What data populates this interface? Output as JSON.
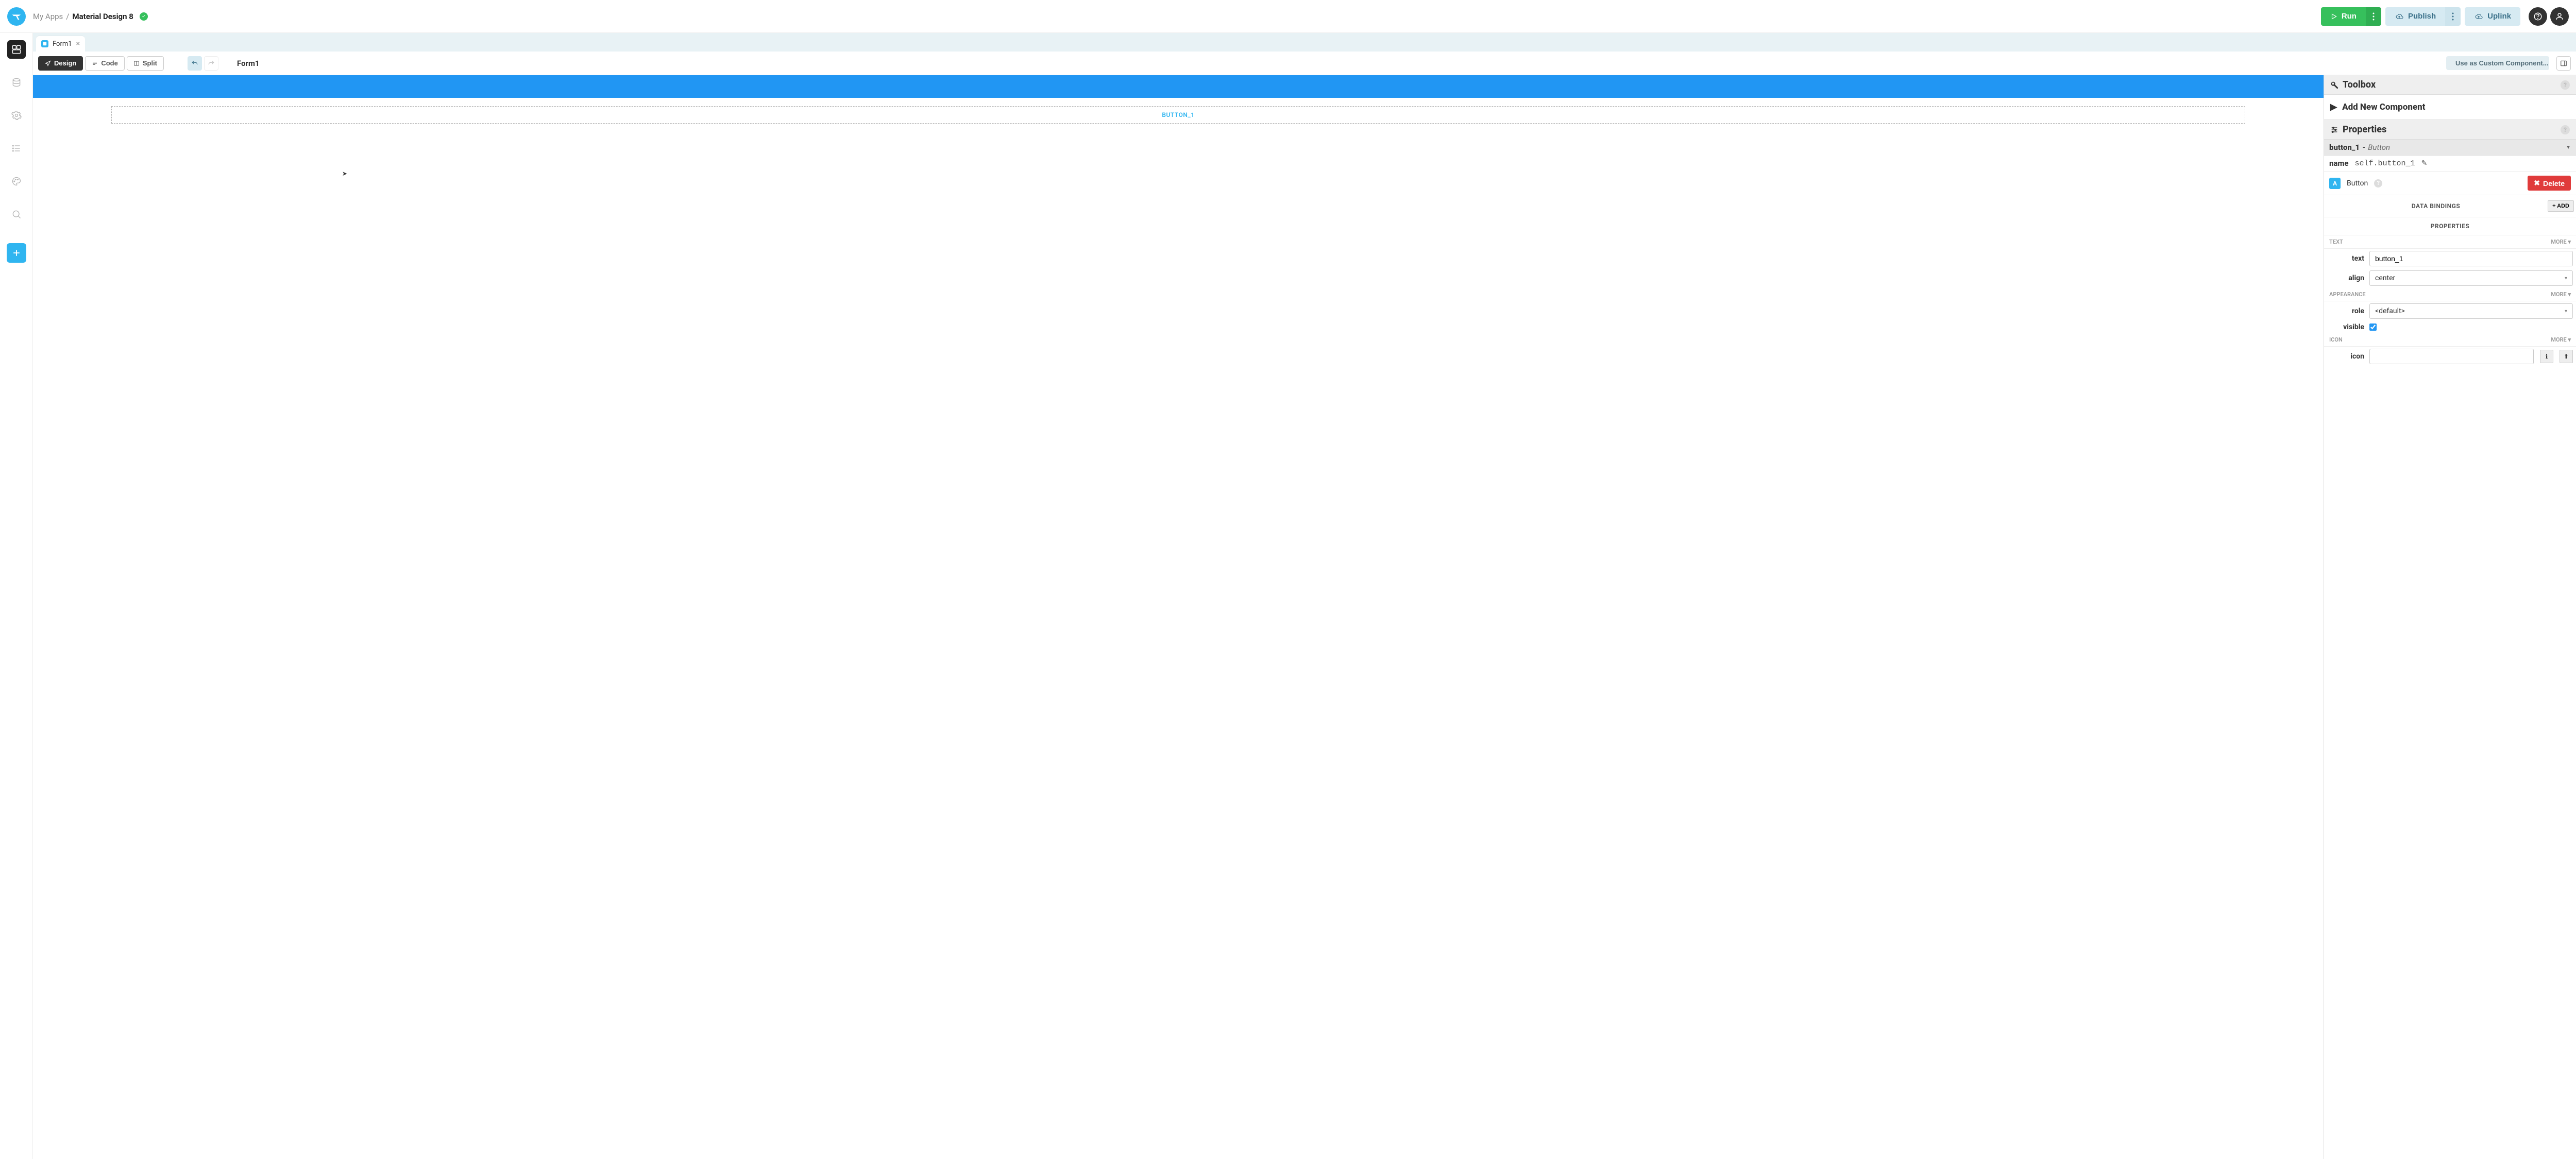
{
  "breadcrumb": {
    "root": "My Apps",
    "sep": "/",
    "current": "Material Design 8"
  },
  "topbar": {
    "run": "Run",
    "publish": "Publish",
    "uplink": "Uplink"
  },
  "tab": {
    "name": "Form1"
  },
  "toolbar": {
    "design": "Design",
    "code": "Code",
    "split": "Split",
    "form_name": "Form1",
    "custom_component": "Use as Custom Component..."
  },
  "canvas": {
    "button_placeholder": "BUTTON_1"
  },
  "toolbox": {
    "title": "Toolbox",
    "add_new": "Add New Component"
  },
  "properties": {
    "title": "Properties",
    "selected_name": "button_1",
    "selected_type": "Button",
    "name_label": "name",
    "name_value": "self.button_1",
    "comp_type_label": "Button",
    "delete_label": "Delete",
    "data_bindings_label": "DATA BINDINGS",
    "add_label": "ADD",
    "properties_label": "PROPERTIES",
    "groups": {
      "text": {
        "header": "TEXT",
        "more": "MORE ▾",
        "text_label": "text",
        "text_value": "button_1",
        "align_label": "align",
        "align_value": "center"
      },
      "appearance": {
        "header": "APPEARANCE",
        "more": "MORE ▾",
        "role_label": "role",
        "role_value": "<default>",
        "visible_label": "visible",
        "visible_checked": true
      },
      "icon": {
        "header": "ICON",
        "more": "MORE ▾",
        "icon_label": "icon",
        "icon_value": ""
      }
    }
  }
}
